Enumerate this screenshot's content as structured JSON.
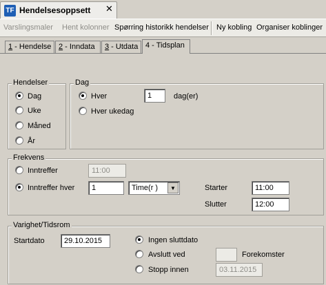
{
  "document_tab": {
    "logo": "TF",
    "title": "Hendelsesoppsett",
    "close": "✕"
  },
  "toolbar": {
    "varslingsmaler": "Varslingsmaler",
    "hent_kolonner": "Hent kolonner",
    "sporring": "Spørring historikk hendelser",
    "ny_kobling": "Ny kobling",
    "organiser": "Organiser koblinger"
  },
  "tabs": {
    "t1_num": "1",
    "t1_label": " - Hendelse",
    "t2_num": "2",
    "t2_label": " - Inndata",
    "t3_num": "3",
    "t3_label": " - Utdata",
    "t4_label": "4 - Tidsplan"
  },
  "hendelser": {
    "legend": "Hendelser",
    "options": [
      "Dag",
      "Uke",
      "Måned",
      "År"
    ],
    "selected": "Dag"
  },
  "dag": {
    "legend": "Dag",
    "hver_label": "Hver",
    "hver_value": "1",
    "unit": "dag(er)",
    "hver_ukedag": "Hver ukedag",
    "selected": "Hver"
  },
  "frekvens": {
    "legend": "Frekvens",
    "inntreffer_label": "Inntreffer",
    "inntreffer_time": "11:00",
    "inntreffer_hver_label": "Inntreffer hver",
    "hver_value": "1",
    "unit_select": "Time(r )",
    "starter_label": "Starter",
    "starter_value": "11:00",
    "slutter_label": "Slutter",
    "slutter_value": "12:00",
    "selected": "Inntreffer hver"
  },
  "varighet": {
    "legend": "Varighet/Tidsrom",
    "startdato_label": "Startdato",
    "startdato_value": "29.10.2015",
    "ingen_sluttdato": "Ingen sluttdato",
    "avslutt_ved": "Avslutt ved",
    "forekomster_value": "",
    "forekomster_label": "Forekomster",
    "stopp_innen": "Stopp innen",
    "stopp_date": "03.11.2015",
    "selected": "Ingen sluttdato"
  }
}
